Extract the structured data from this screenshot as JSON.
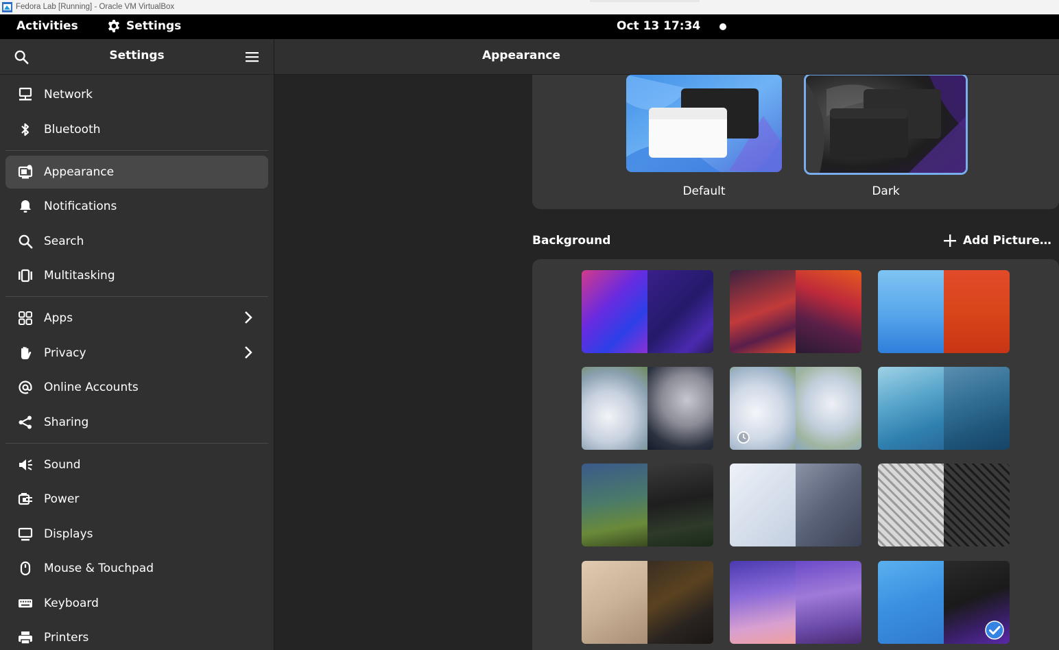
{
  "vbox_title": "Fedora Lab [Running] - Oracle VM VirtualBox",
  "topbar": {
    "activities": "Activities",
    "app_name": "Settings",
    "clock": "Oct 13  17:34"
  },
  "sidebar": {
    "title": "Settings",
    "items": [
      {
        "label": "Network",
        "icon": "network-icon"
      },
      {
        "label": "Bluetooth",
        "icon": "bluetooth-icon"
      },
      {
        "label": "Appearance",
        "icon": "appearance-icon",
        "active": true
      },
      {
        "label": "Notifications",
        "icon": "bell-icon"
      },
      {
        "label": "Search",
        "icon": "search-icon"
      },
      {
        "label": "Multitasking",
        "icon": "multitasking-icon"
      },
      {
        "label": "Apps",
        "icon": "apps-icon",
        "chevron": true
      },
      {
        "label": "Privacy",
        "icon": "hand-icon",
        "chevron": true
      },
      {
        "label": "Online Accounts",
        "icon": "at-icon"
      },
      {
        "label": "Sharing",
        "icon": "share-icon"
      },
      {
        "label": "Sound",
        "icon": "speaker-icon"
      },
      {
        "label": "Power",
        "icon": "power-icon"
      },
      {
        "label": "Displays",
        "icon": "display-icon"
      },
      {
        "label": "Mouse & Touchpad",
        "icon": "mouse-icon"
      },
      {
        "label": "Keyboard",
        "icon": "keyboard-icon"
      },
      {
        "label": "Printers",
        "icon": "printer-icon"
      }
    ]
  },
  "main": {
    "title": "Appearance",
    "styles": [
      {
        "label": "Default",
        "selected": false
      },
      {
        "label": "Dark",
        "selected": true
      }
    ],
    "background_title": "Background",
    "add_picture": "Add Picture…"
  },
  "colors": {
    "accent": "#78aeed",
    "sidebar_bg": "#303030",
    "content_bg": "#242424",
    "card_bg": "#383838"
  }
}
